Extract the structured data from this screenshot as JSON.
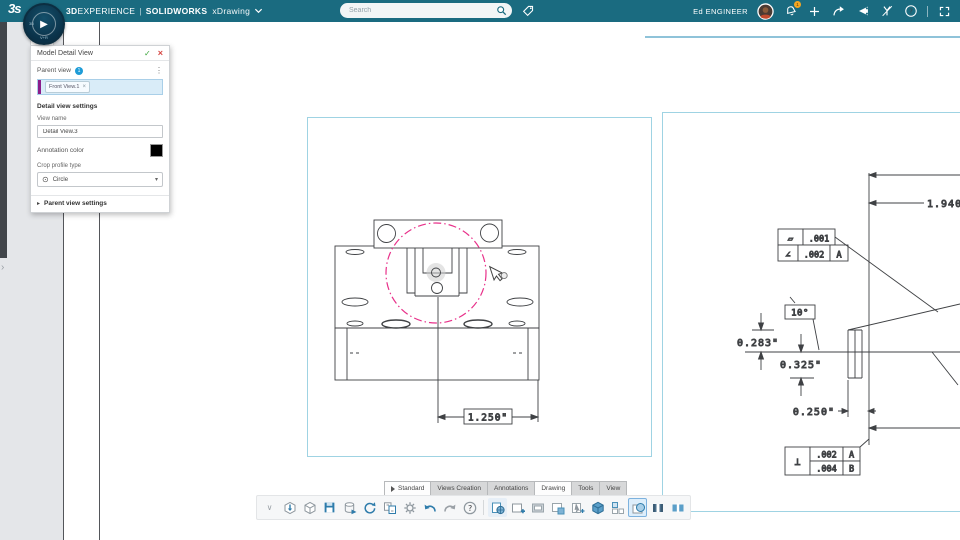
{
  "topbar": {
    "logo": "3s",
    "brand_bold": "3D",
    "brand_rest": "EXPERIENCE",
    "divider": "|",
    "product": "SOLIDWORKS",
    "app": "xDrawing",
    "search_placeholder": "Search",
    "user_name": "Ed ENGINEER",
    "notification_count": "1",
    "icons": [
      "3ds-logo",
      "compass",
      "search",
      "tag",
      "avatar",
      "notification-bell",
      "add",
      "forward-share",
      "share",
      "tools",
      "help",
      "fullscreen"
    ]
  },
  "left_rail": {
    "expander": "›"
  },
  "panel": {
    "title": "Model Detail View",
    "confirm": "✓",
    "cancel": "×",
    "parent_view_label": "Parent view",
    "parent_view_count": "1",
    "menu": "⋮",
    "selected_chip": "Front View.1",
    "chip_remove": "×",
    "section_title": "Detail view settings",
    "view_name_label": "View name",
    "view_name_value": "Detail View.3",
    "annotation_color_label": "Annotation color",
    "annotation_color_value": "#000000",
    "crop_profile_label": "Crop profile type",
    "crop_profile_icon": "⊙",
    "crop_profile_value": "Circle",
    "dropdown_arrow": "▾",
    "collapse_arrow": "▸",
    "parent_settings_label": "Parent view settings"
  },
  "tabs": {
    "items": [
      {
        "label": "Standard",
        "active": true
      },
      {
        "label": "Views Creation",
        "active": false
      },
      {
        "label": "Annotations",
        "active": false
      },
      {
        "label": "Drawing",
        "active": true
      },
      {
        "label": "Tools",
        "active": false
      },
      {
        "label": "View",
        "active": false
      }
    ]
  },
  "toolbar": {
    "collapse_glyph": "∨",
    "icons": [
      "collapse",
      "import-model",
      "export-model",
      "save",
      "save-to-database",
      "refresh",
      "exchange-data",
      "settings",
      "undo",
      "redo",
      "help",
      "update-views",
      "new-view",
      "projected-view",
      "save-view",
      "annotation-view",
      "isometric-view",
      "projection-layout",
      "detail-view",
      "section-view",
      "broken-out-section"
    ],
    "selected": "detail-view"
  },
  "drawing": {
    "front": {
      "dim_width": "1.250\""
    },
    "side": {
      "dim_height": "1.940",
      "dim_angle": "10°",
      "dim_a": "0.283\"",
      "dim_b": "0.325\"",
      "dim_c": "0.250\"",
      "fcf_top": {
        "row1_symbol": "▱",
        "row1_value": ".001",
        "row2_symbol": "∠",
        "row2_value": ".002",
        "row2_datum": "A"
      },
      "fcf_bottom": {
        "symbol": "⊥",
        "row1_value": ".002",
        "row1_datum": "A",
        "row2_value": ".004",
        "row2_datum": "B"
      }
    },
    "colors": {
      "detail_circle": "#e8318a",
      "view_border": "#9fd3e3",
      "line": "#3f4144"
    }
  }
}
